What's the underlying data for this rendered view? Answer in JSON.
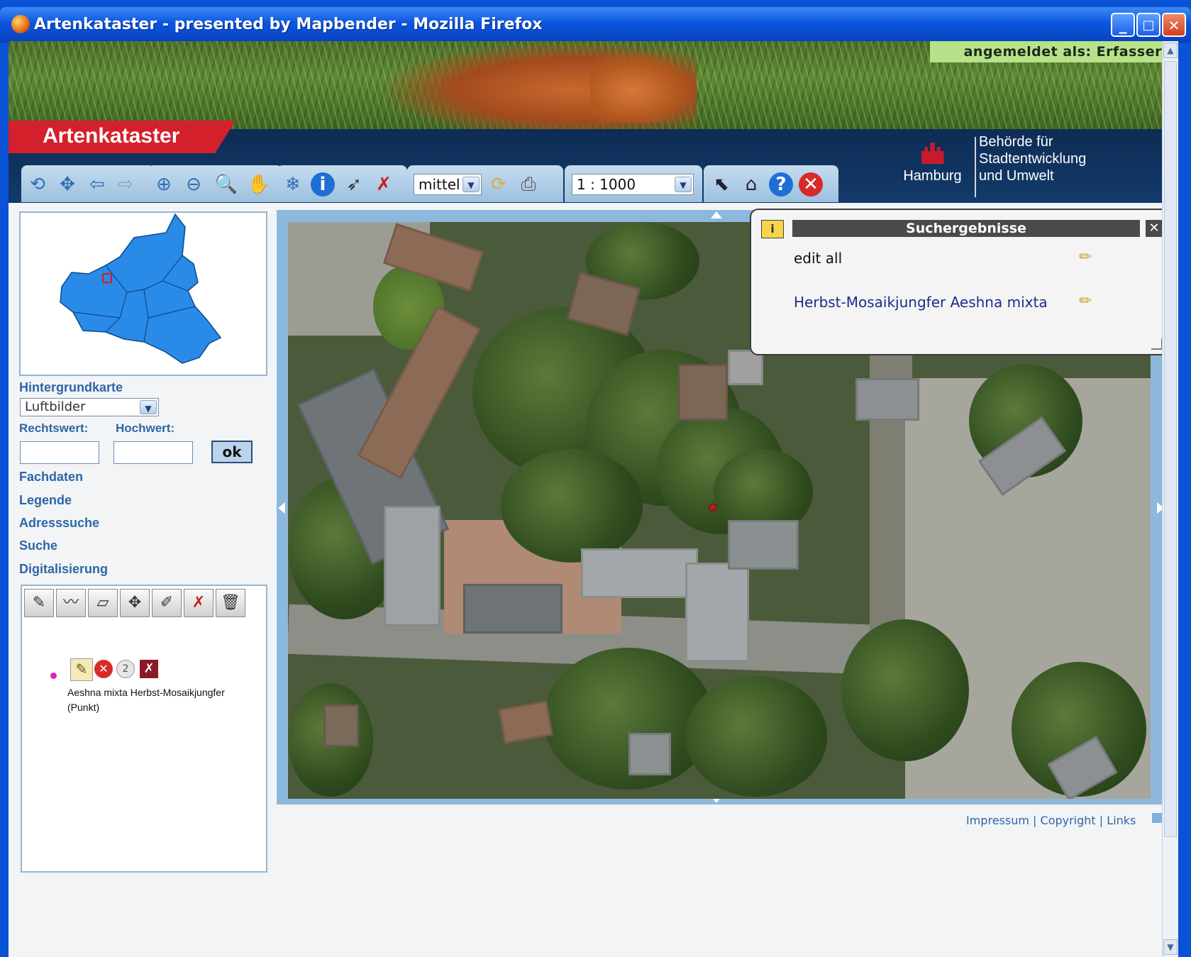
{
  "window": {
    "title": "Artenkataster - presented by Mapbender - Mozilla Firefox",
    "buttons": {
      "minimize": "_",
      "maximize": "□",
      "close": "✕"
    }
  },
  "header": {
    "login_label": "angemeldet als: Erfasser",
    "app_title": "Artenkataster",
    "city": "Hamburg",
    "authority_lines": [
      "Behörde für",
      "Stadtentwicklung",
      "und Umwelt"
    ]
  },
  "toolbar": {
    "quality_select": "mittel",
    "scale_select": "1 : 1000"
  },
  "sidebar": {
    "background_label": "Hintergrundkarte",
    "background_value": "Luftbilder",
    "rechtswert_label": "Rechtswert:",
    "hochwert_label": "Hochwert:",
    "rechtswert_value": "",
    "hochwert_value": "",
    "ok_label": "ok",
    "links": [
      "Fachdaten",
      "Legende",
      "Adresssuche",
      "Suche",
      "Digitalisierung"
    ],
    "feature_label_line1": "Aeshna mixta Herbst-Mosaikjungfer",
    "feature_label_line2": "(Punkt)",
    "feature_badge": "2"
  },
  "popup": {
    "title": "Suchergebnisse",
    "info_glyph": "i",
    "close_glyph": "✕",
    "rows": [
      {
        "text": "edit all",
        "color": "#111111"
      },
      {
        "text": "Herbst-Mosaikjungfer Aeshna mixta",
        "color": "#1a2d8a"
      }
    ]
  },
  "footer": {
    "impressum": "Impressum",
    "copyright": "Copyright",
    "links": "Links",
    "sep": "|"
  },
  "colors": {
    "accent_red": "#d4202b",
    "nav_blue": "#123a6a",
    "label_blue": "#2e66a6",
    "map_frame": "#8cb8dc"
  }
}
